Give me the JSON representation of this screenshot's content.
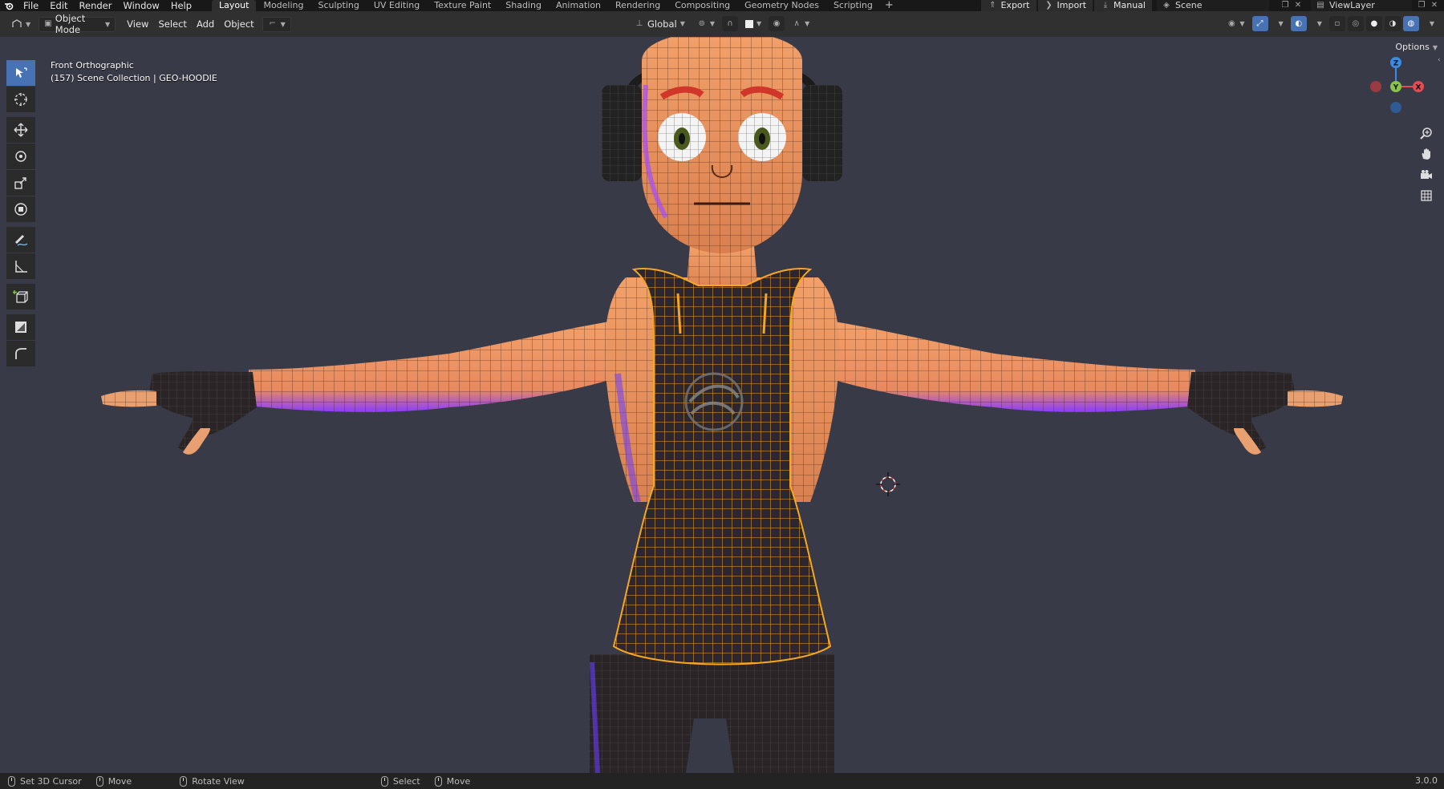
{
  "menu": {
    "items": [
      "File",
      "Edit",
      "Render",
      "Window",
      "Help"
    ]
  },
  "workspaces": {
    "tabs": [
      "Layout",
      "Modeling",
      "Sculpting",
      "UV Editing",
      "Texture Paint",
      "Shading",
      "Animation",
      "Rendering",
      "Compositing",
      "Geometry Nodes",
      "Scripting"
    ],
    "active": "Layout"
  },
  "topright": {
    "export_label": "Export",
    "import_label": "Import",
    "manual_label": "Manual",
    "scene_name": "Scene",
    "viewlayer_name": "ViewLayer"
  },
  "header": {
    "mode": "Object Mode",
    "menus": [
      "View",
      "Select",
      "Add",
      "Object"
    ],
    "orientation": "Global",
    "options_label": "Options"
  },
  "viewport": {
    "view_name": "Front Orthographic",
    "collection_info": "(157) Scene Collection | GEO-HOODIE",
    "background_color": "#393a47",
    "selection_color": "#f5a623"
  },
  "gizmo": {
    "axis_x": "X",
    "axis_y": "Y",
    "axis_z": "Z",
    "x_color": "#e34c55",
    "y_color": "#8bc34a",
    "z_color": "#3b8be0"
  },
  "toolbar": {
    "tools": [
      "select-box",
      "cursor",
      "move",
      "rotate",
      "scale",
      "transform",
      "annotate",
      "measure",
      "add-cube",
      "gap",
      "shear",
      "radius"
    ]
  },
  "statusbar": {
    "items": [
      "Set 3D Cursor",
      "Move",
      "Rotate View",
      "Select",
      "Move"
    ],
    "version": "3.0.0"
  }
}
